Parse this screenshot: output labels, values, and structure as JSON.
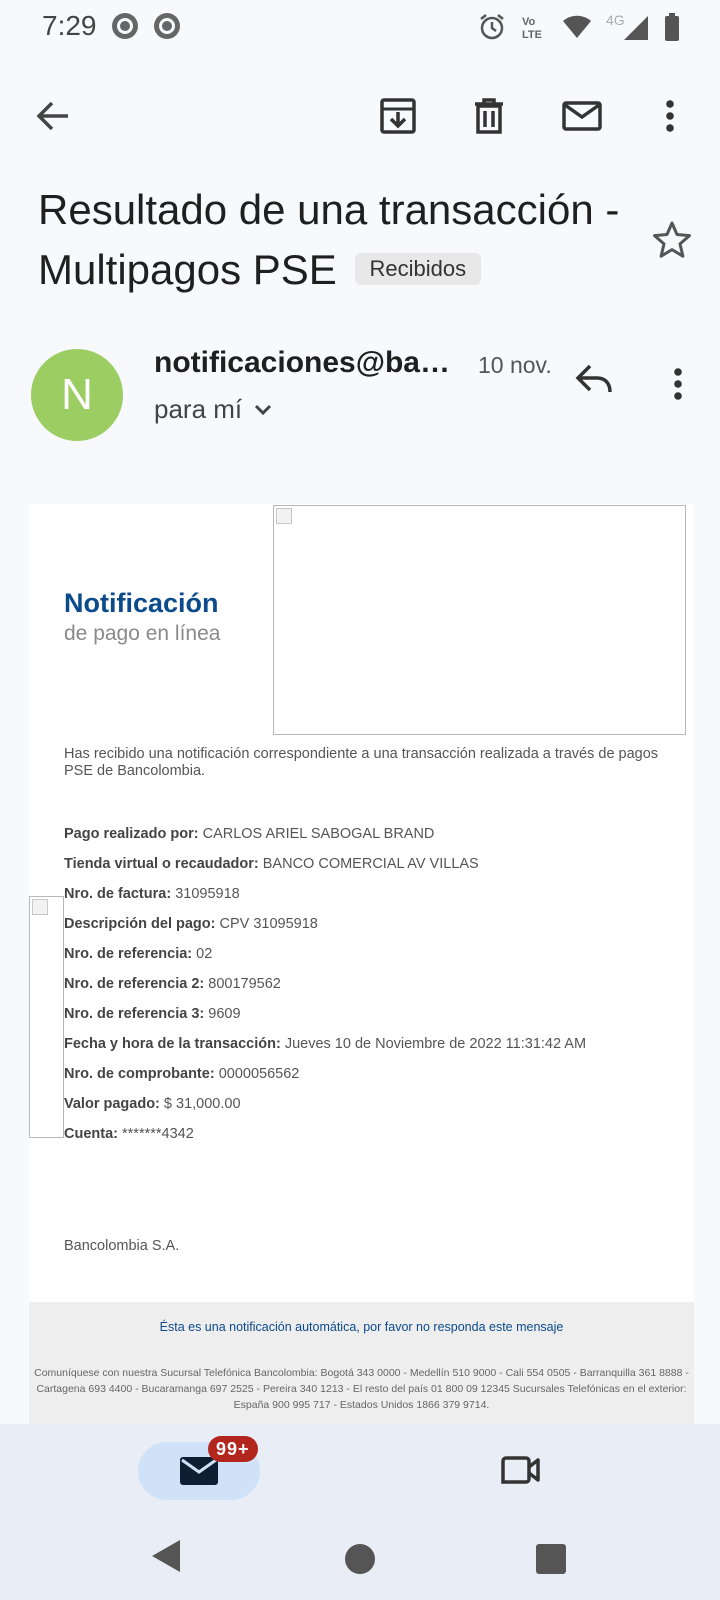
{
  "status_bar": {
    "time": "7:29",
    "left_icons": [
      "notification-icon",
      "notification-icon"
    ],
    "right_icons": [
      "alarm-icon",
      "volte-icon",
      "wifi-icon",
      "4g-icon",
      "signal-icon",
      "battery-icon"
    ],
    "volte_text_top": "Vo",
    "volte_text_bottom": "LTE",
    "network_label": "4G"
  },
  "toolbar": {
    "back": "back-arrow-icon",
    "actions": [
      "archive-icon",
      "delete-icon",
      "mark-unread-icon",
      "more-vert-icon"
    ]
  },
  "email": {
    "subject": "Resultado de una transacción - Multipagos PSE",
    "label": "Recibidos",
    "sender_initial": "N",
    "sender": "notificaciones@bancolombia.com.co",
    "date": "10 nov.",
    "recipient": "para mí"
  },
  "message": {
    "title": "Notificación",
    "subtitle": "de pago en línea",
    "intro": "Has recibido una notificación correspondiente a una transacción realizada a través de pagos PSE de Bancolombia.",
    "details": [
      {
        "label": "Pago realizado por:",
        "value": "CARLOS ARIEL SABOGAL BRAND"
      },
      {
        "label": "Tienda virtual o recaudador:",
        "value": "BANCO COMERCIAL AV VILLAS"
      },
      {
        "label": "Nro. de factura:",
        "value": "31095918"
      },
      {
        "label": "Descripción del pago:",
        "value": "CPV 31095918"
      },
      {
        "label": "Nro. de referencia:",
        "value": "02"
      },
      {
        "label": "Nro. de referencia 2:",
        "value": "800179562"
      },
      {
        "label": "Nro. de referencia 3:",
        "value": "9609"
      },
      {
        "label": "Fecha y hora de la transacción:",
        "value": "Jueves 10 de Noviembre de 2022 11:31:42 AM"
      },
      {
        "label": "Nro. de comprobante:",
        "value": "0000056562"
      },
      {
        "label": "Valor pagado:",
        "value": "$ 31,000.00"
      },
      {
        "label": "Cuenta:",
        "value": "*******4342"
      }
    ],
    "company": "Bancolombia S.A.",
    "footer_notice": "Ésta es una notificación automática, por favor no responda este mensaje",
    "footer_contacts": "Comuníquese con nuestra Sucursal Telefónica Bancolombia: Bogotá 343 0000 - Medellín 510 9000 - Cali 554 0505 - Barranquilla 361 8888 - Cartagena 693 4400 - Bucaramanga 697 2525 - Pereira 340 1213 - El resto del país 01 800 09 12345 Sucursales Telefónicas en el exterior: España 900 995 717 - Estados Unidos 1866 379 9714."
  },
  "bottom_nav": {
    "mail_badge": "99+",
    "items": [
      "mail-icon",
      "video-icon"
    ]
  },
  "colors": {
    "avatar": "#9ccd63",
    "title_blue": "#0b4a8b",
    "badge_red": "#b3261e",
    "nav_pill": "#cfe2f8"
  }
}
